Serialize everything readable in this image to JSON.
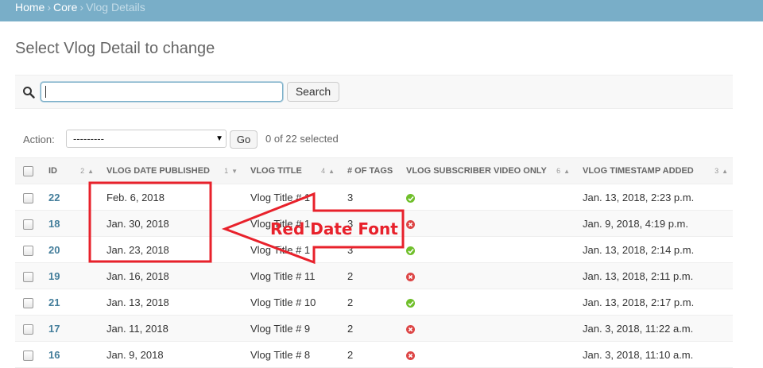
{
  "breadcrumbs": {
    "home": "Home",
    "sep": "›",
    "app": "Core",
    "current": "Vlog Details"
  },
  "page_title": "Select Vlog Detail to change",
  "search": {
    "button_label": "Search",
    "value": ""
  },
  "actions": {
    "label": "Action:",
    "selected_value": "---------",
    "go_label": "Go",
    "selected_count": "0 of 22 selected"
  },
  "columns": [
    {
      "label": "ID",
      "sort_priority": "2",
      "sort_dir": "▲"
    },
    {
      "label": "VLOG DATE PUBLISHED",
      "sort_priority": "1",
      "sort_dir": "▼"
    },
    {
      "label": "VLOG TITLE",
      "sort_priority": "4",
      "sort_dir": "▲"
    },
    {
      "label": "# OF TAGS",
      "sort_priority": "",
      "sort_dir": ""
    },
    {
      "label": "VLOG SUBSCRIBER VIDEO ONLY",
      "sort_priority": "6",
      "sort_dir": "▲"
    },
    {
      "label": "VLOG TIMESTAMP ADDED",
      "sort_priority": "3",
      "sort_dir": "▲"
    }
  ],
  "rows": [
    {
      "id": "22",
      "date": "Feb. 6, 2018",
      "title": "Vlog Title # 1",
      "tags": "3",
      "subscriber_only": true,
      "timestamp": "Jan. 13, 2018, 2:23 p.m."
    },
    {
      "id": "18",
      "date": "Jan. 30, 2018",
      "title": "Vlog Title # 1",
      "tags": "3",
      "subscriber_only": false,
      "timestamp": "Jan. 9, 2018, 4:19 p.m."
    },
    {
      "id": "20",
      "date": "Jan. 23, 2018",
      "title": "Vlog Title # 1",
      "tags": "3",
      "subscriber_only": true,
      "timestamp": "Jan. 13, 2018, 2:14 p.m."
    },
    {
      "id": "19",
      "date": "Jan. 16, 2018",
      "title": "Vlog Title # 11",
      "tags": "2",
      "subscriber_only": false,
      "timestamp": "Jan. 13, 2018, 2:11 p.m."
    },
    {
      "id": "21",
      "date": "Jan. 13, 2018",
      "title": "Vlog Title # 10",
      "tags": "2",
      "subscriber_only": true,
      "timestamp": "Jan. 13, 2018, 2:17 p.m."
    },
    {
      "id": "17",
      "date": "Jan. 11, 2018",
      "title": "Vlog Title # 9",
      "tags": "2",
      "subscriber_only": false,
      "timestamp": "Jan. 3, 2018, 11:22 a.m."
    },
    {
      "id": "16",
      "date": "Jan. 9, 2018",
      "title": "Vlog Title # 8",
      "tags": "2",
      "subscriber_only": false,
      "timestamp": "Jan. 3, 2018, 11:10 a.m."
    }
  ],
  "annotation": {
    "text": "Red Date Font",
    "color": "#e8212b"
  },
  "colors": {
    "header_bar": "#79aec8",
    "link": "#447e9b",
    "true_icon": "#70bf2b",
    "false_icon": "#dd4646"
  }
}
